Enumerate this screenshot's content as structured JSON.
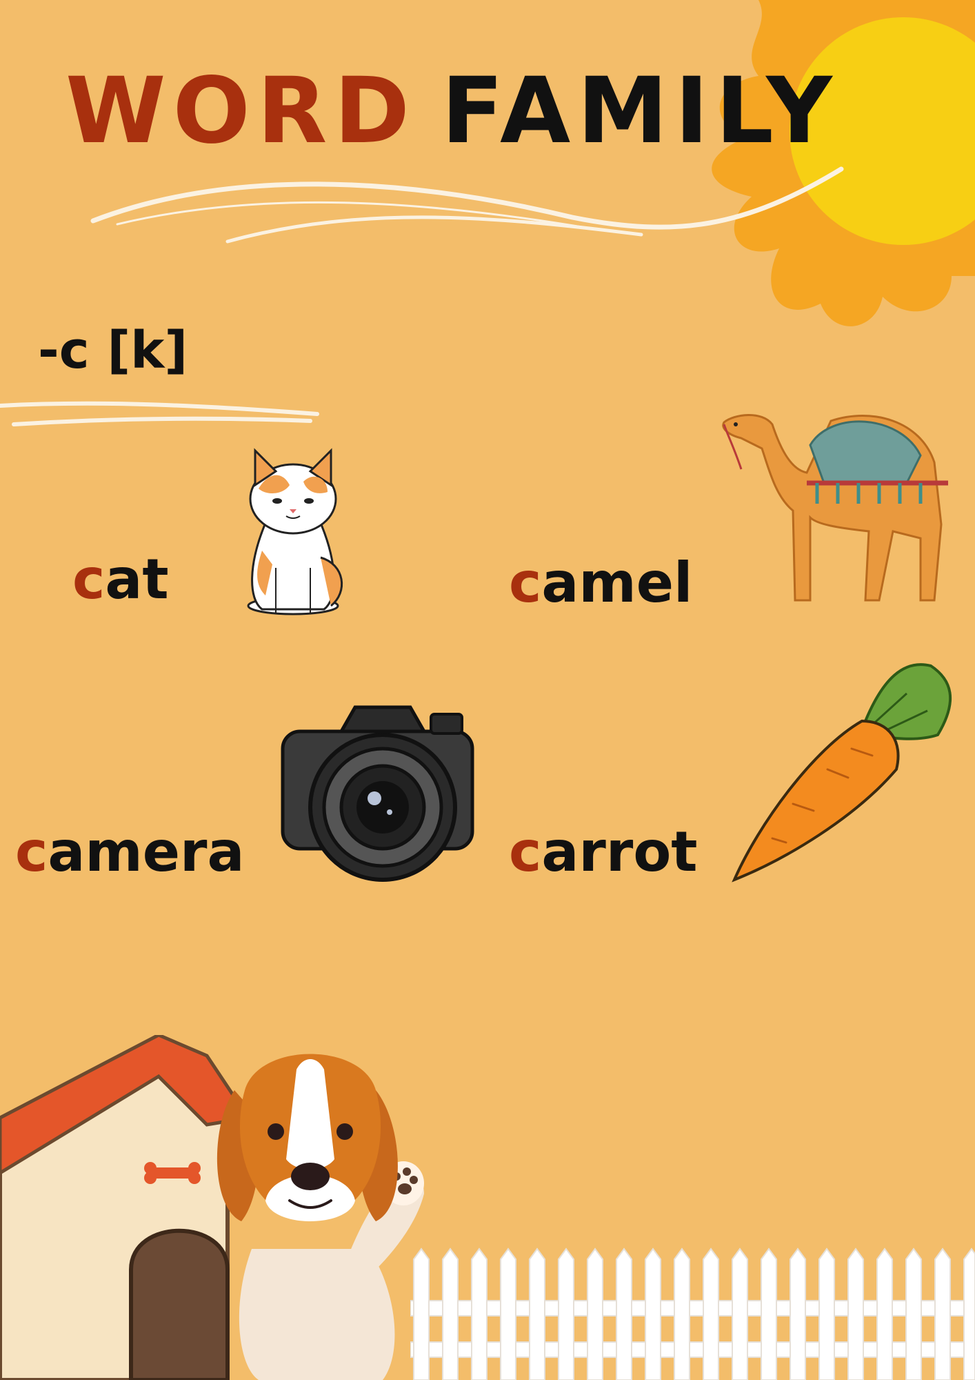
{
  "title": {
    "word1": "WORD",
    "word2": "FAMILY"
  },
  "subtitle": "-c [k]",
  "words": [
    {
      "first": "c",
      "rest": "at",
      "icon": "cat-icon"
    },
    {
      "first": "c",
      "rest": "amel",
      "icon": "camel-icon"
    },
    {
      "first": "c",
      "rest": "amera",
      "icon": "camera-icon"
    },
    {
      "first": "c",
      "rest": "arrot",
      "icon": "carrot-icon"
    }
  ],
  "decorations": [
    "sun-icon",
    "dog-house-icon",
    "dog-icon",
    "fence-icon"
  ],
  "colors": {
    "background": "#f3bd6a",
    "accent": "#a8300e",
    "text": "#111111",
    "sun_core": "#f7cf14",
    "sun_rays": "#f5a623"
  }
}
